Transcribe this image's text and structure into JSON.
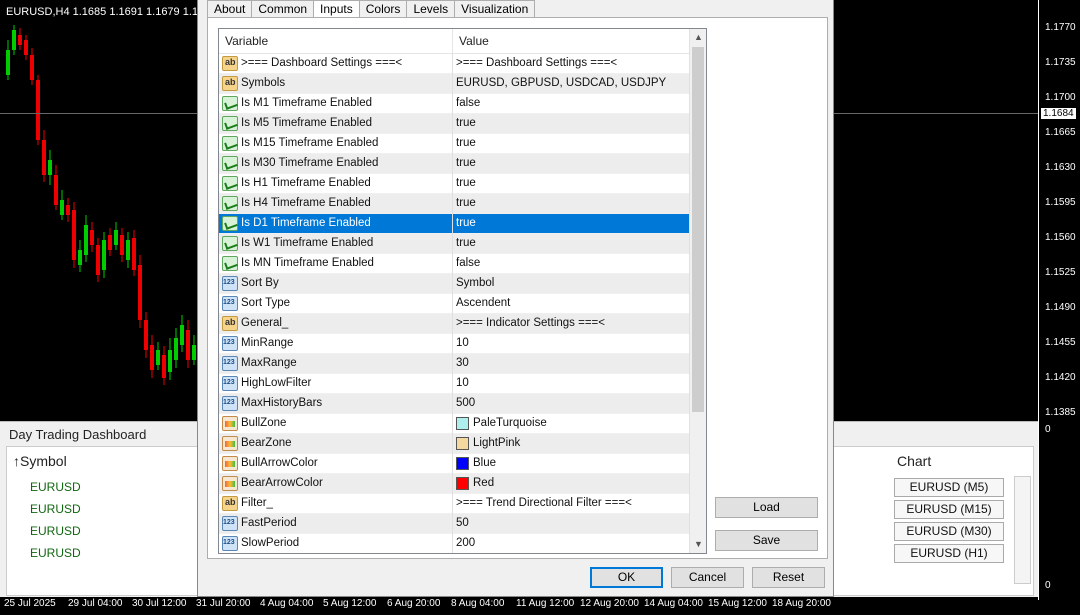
{
  "chart": {
    "title": "EURUSD,H4  1.1685 1.1691 1.1679 1.1684",
    "prices": [
      "1.1770",
      "1.1735",
      "1.1700",
      "1.1684",
      "1.1665",
      "1.1630",
      "1.1595",
      "1.1560",
      "1.1525",
      "1.1490",
      "1.1455",
      "1.1420",
      "1.1385",
      "0",
      "0"
    ],
    "times": [
      "25 Jul 2025",
      "29 Jul 04:00",
      "30 Jul 12:00",
      "31 Jul 20:00",
      "4 Aug 04:00",
      "5 Aug 12:00",
      "6 Aug 20:00",
      "8 Aug 04:00",
      "11 Aug 12:00",
      "12 Aug 20:00",
      "14 Aug 04:00",
      "15 Aug 12:00",
      "18 Aug 20:00"
    ],
    "colors": {
      "bull": "#00cc00",
      "bear": "#ee0000"
    }
  },
  "dashboard": {
    "title": "Day Trading Dashboard",
    "symbol_header": "↑Symbol",
    "symbols": [
      "EURUSD",
      "EURUSD",
      "EURUSD",
      "EURUSD"
    ],
    "chart_header": "Chart",
    "chart_buttons": [
      "EURUSD (M5)",
      "EURUSD (M15)",
      "EURUSD (M30)",
      "EURUSD (H1)"
    ]
  },
  "dialog": {
    "tabs": [
      "About",
      "Common",
      "Inputs",
      "Colors",
      "Levels",
      "Visualization"
    ],
    "active_tab": "Inputs",
    "columns": {
      "variable": "Variable",
      "value": "Value"
    },
    "rows": [
      {
        "icon": "ab",
        "variable": ">=== Dashboard Settings ===<",
        "value": ">=== Dashboard Settings ===<"
      },
      {
        "icon": "ab",
        "variable": "Symbols",
        "value": "EURUSD, GBPUSD, USDCAD, USDJPY"
      },
      {
        "icon": "bool",
        "variable": "Is M1 Timeframe Enabled",
        "value": "false"
      },
      {
        "icon": "bool",
        "variable": "Is M5 Timeframe Enabled",
        "value": "true"
      },
      {
        "icon": "bool",
        "variable": "Is M15 Timeframe Enabled",
        "value": "true"
      },
      {
        "icon": "bool",
        "variable": "Is M30 Timeframe Enabled",
        "value": "true"
      },
      {
        "icon": "bool",
        "variable": "Is H1 Timeframe Enabled",
        "value": "true"
      },
      {
        "icon": "bool",
        "variable": "Is H4 Timeframe Enabled",
        "value": "true"
      },
      {
        "icon": "bool",
        "variable": "Is D1 Timeframe Enabled",
        "value": "true",
        "selected": true
      },
      {
        "icon": "bool",
        "variable": "Is W1 Timeframe Enabled",
        "value": "true"
      },
      {
        "icon": "bool",
        "variable": "Is MN Timeframe Enabled",
        "value": "false"
      },
      {
        "icon": "num",
        "variable": "Sort By",
        "value": "Symbol"
      },
      {
        "icon": "num",
        "variable": "Sort Type",
        "value": "Ascendent"
      },
      {
        "icon": "ab",
        "variable": "General_",
        "value": ">=== Indicator Settings ===<"
      },
      {
        "icon": "num",
        "variable": "MinRange",
        "value": "10"
      },
      {
        "icon": "num",
        "variable": "MaxRange",
        "value": "30"
      },
      {
        "icon": "num",
        "variable": "HighLowFilter",
        "value": "10"
      },
      {
        "icon": "num",
        "variable": "MaxHistoryBars",
        "value": "500"
      },
      {
        "icon": "color",
        "variable": "BullZone",
        "value": "PaleTurquoise",
        "swatch": "#afeeee"
      },
      {
        "icon": "color",
        "variable": "BearZone",
        "value": "LightPink",
        "swatch": "#f5d7a0"
      },
      {
        "icon": "color",
        "variable": "BullArrowColor",
        "value": "Blue",
        "swatch": "#0000ff"
      },
      {
        "icon": "color",
        "variable": "BearArrowColor",
        "value": "Red",
        "swatch": "#ff0000"
      },
      {
        "icon": "ab",
        "variable": "Filter_",
        "value": ">=== Trend Directional Filter ===<"
      },
      {
        "icon": "num",
        "variable": "FastPeriod",
        "value": "50"
      },
      {
        "icon": "num",
        "variable": "SlowPeriod",
        "value": "200"
      }
    ],
    "load_label": "Load",
    "save_label": "Save",
    "ok_label": "OK",
    "cancel_label": "Cancel",
    "reset_label": "Reset"
  }
}
